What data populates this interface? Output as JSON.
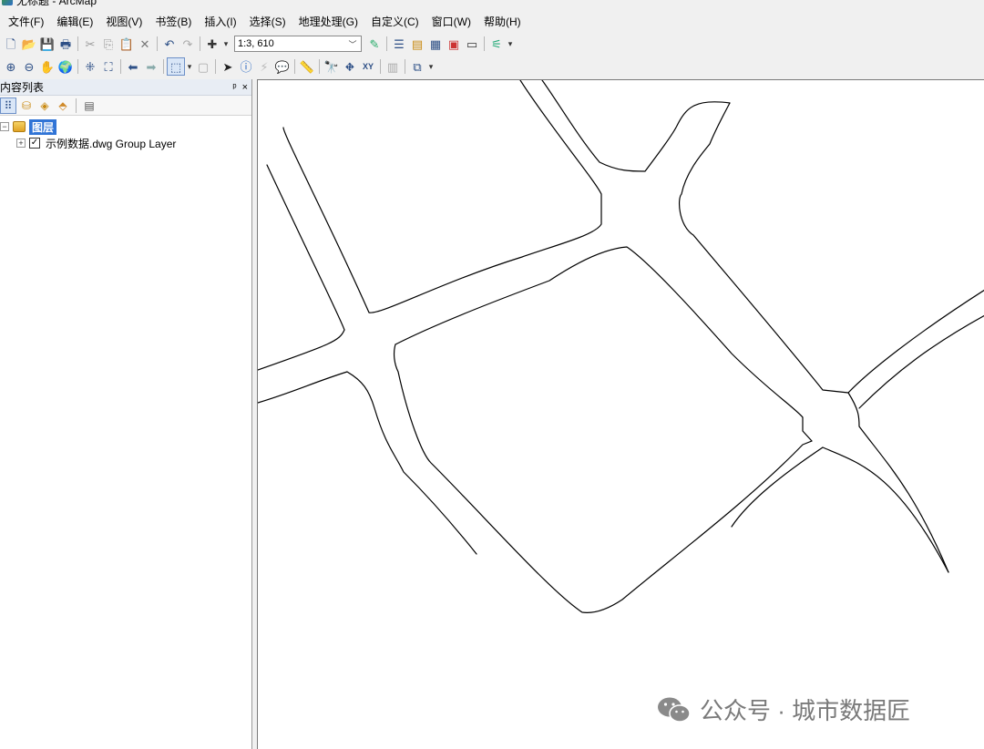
{
  "window": {
    "title": "无标题 - ArcMap"
  },
  "menubar": {
    "items": [
      "文件(F)",
      "编辑(E)",
      "视图(V)",
      "书签(B)",
      "插入(I)",
      "选择(S)",
      "地理处理(G)",
      "自定义(C)",
      "窗口(W)",
      "帮助(H)"
    ]
  },
  "toolbar": {
    "scale": "1:3, 610",
    "icons": [
      "new-document-icon",
      "open-folder-icon",
      "save-icon",
      "print-icon",
      "cut-icon",
      "copy-icon",
      "paste-icon",
      "delete-icon",
      "undo-icon",
      "redo-icon",
      "add-data-icon",
      "editor-icon",
      "table-of-contents-icon",
      "catalog-icon",
      "search-window-icon",
      "arctoolbox-icon",
      "python-icon",
      "model-builder-icon",
      "zoom-in-icon",
      "zoom-out-icon",
      "pan-icon",
      "full-extent-icon",
      "fixed-zoom-in-icon",
      "fixed-zoom-out-icon",
      "back-icon",
      "forward-icon",
      "select-features-icon",
      "clear-selection-icon",
      "select-elements-icon",
      "identify-icon",
      "hyperlink-icon",
      "html-popup-icon",
      "measure-icon",
      "find-icon",
      "find-route-icon",
      "go-to-xy-icon",
      "time-slider-icon",
      "create-viewer-icon"
    ]
  },
  "toc": {
    "title": "内容列表",
    "pin_label": "ᵖ",
    "close_label": "×",
    "root_label": "图层",
    "layer_label": "示例数据.dwg Group Layer",
    "layer_checked": "✓"
  },
  "watermark": {
    "text": "公众号 · 城市数据匠"
  }
}
